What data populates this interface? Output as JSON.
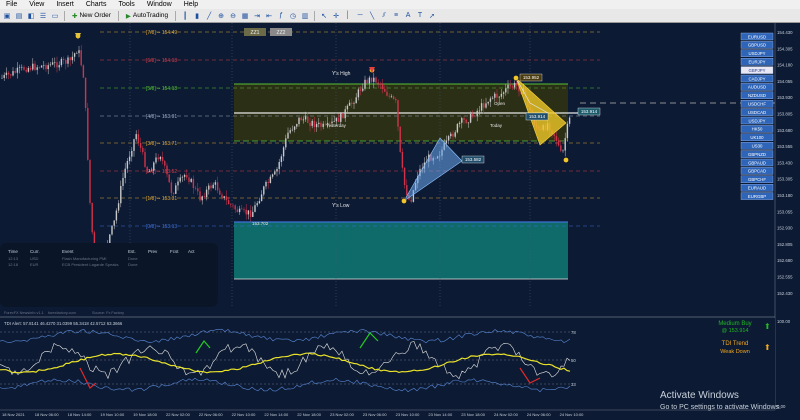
{
  "menu": [
    "File",
    "View",
    "Insert",
    "Charts",
    "Tools",
    "Window",
    "Help"
  ],
  "toolbar": {
    "new_order": "New Order",
    "autotrading": "AutoTrading"
  },
  "tabs": [
    "ZZ1",
    "ZZ2"
  ],
  "levels": [
    {
      "label": "[7/8] -- 154.49",
      "color": "#d8a43a"
    },
    {
      "label": "[6/8] -- 154.18",
      "color": "#d33c4a"
    },
    {
      "label": "[5/8] -- 154.18",
      "color": "#55c233"
    },
    {
      "label": "[4/8] -- 153.91",
      "color": "#9aa8c0"
    },
    {
      "label": "[3/8] -- 153.71",
      "color": "#d8a43a"
    },
    {
      "label": "[2/8] -- 153.52",
      "color": "#d33c4a"
    },
    {
      "label": "[1/8] -- 153.31",
      "color": "#d8a43a"
    },
    {
      "label": "[0/8] -- 153.13",
      "color": "#3f6fd6"
    }
  ],
  "chart_labels": {
    "ys_high": "Y's High",
    "ys_low": "Y's Low",
    "yesterday": "Yesterday",
    "open": "Open",
    "today": "Today",
    "box_top": "153.702",
    "pattern_a": "153.582",
    "pattern_b": "153.952",
    "pattern_c": "153.914",
    "current": "153.914",
    "low_tag": "153.164"
  },
  "price_axis": [
    "154.430",
    "154.305",
    "154.180",
    "154.055",
    "153.930",
    "153.805",
    "153.680",
    "153.555",
    "153.430",
    "153.305",
    "153.180",
    "153.055",
    "152.930",
    "152.805",
    "152.680",
    "152.555",
    "152.430"
  ],
  "symbols": [
    "EURUSD",
    "GBPUSD",
    "USDJPY",
    "EURJPY",
    "GBPJPY",
    "CADJPY",
    "AUDUSD",
    "NZDUSD",
    "USDCHF",
    "USDCAD",
    "USDJPY",
    "HK50",
    "UK100",
    "US30",
    "GBPNZD",
    "GBPAUD",
    "GBPCAD",
    "GBPCHF",
    "EURAUD",
    "EURGBP"
  ],
  "active_symbol": 4,
  "news": {
    "headers": [
      "Time",
      "Curr.",
      "Event",
      "Est.",
      "Prev",
      "Fcst",
      "Act"
    ],
    "rows": [
      [
        "12:13",
        "USD",
        "Flash Manufacturing PMI",
        "Done",
        "",
        "",
        ""
      ],
      [
        "12:18",
        "EUR",
        "ECB President Lagarde Speaks",
        "Done",
        "",
        "",
        ""
      ]
    ]
  },
  "footer_credit": "ForexFX NewsInfo v1.1",
  "footer_site": "forexfactory.com",
  "footer_source": "Source: Fx Factory",
  "tdi": {
    "title": "TDI Alert: 57.8141 46.4270 31.0399 55.3418 42.5712 63.3666",
    "levels": [
      "78",
      "50",
      "33"
    ],
    "signal1": "Medium Buy",
    "signal1_price": "@ 153.914",
    "signal2": "TDI Trend",
    "signal2_sub": "Weak Down",
    "buy_color": "#23b923",
    "warn_color": "#f2a81c"
  },
  "tdi_axis": [
    "100.00",
    "0.00"
  ],
  "time_axis": [
    "18 Nov 2021",
    "18 Nov 06:00",
    "18 Nov 14:00",
    "19 Nov 10:00",
    "19 Nov 18:00",
    "22 Nov 02:00",
    "22 Nov 06:00",
    "22 Nov 10:00",
    "22 Nov 14:00",
    "22 Nov 18:00",
    "23 Nov 02:00",
    "23 Nov 06:00",
    "23 Nov 10:00",
    "23 Nov 14:00",
    "23 Nov 18:00",
    "24 Nov 02:00",
    "24 Nov 06:00",
    "24 Nov 10:00"
  ],
  "watermark": {
    "title": "Activate Windows",
    "sub": "Go to PC settings to activate Windows."
  },
  "colors": {
    "bg": "#0c1a33",
    "bull": "#c9c9c9",
    "bear": "#d2334a",
    "yellow_band": "#2b2f16",
    "teal_band": "#0f6a6a"
  }
}
